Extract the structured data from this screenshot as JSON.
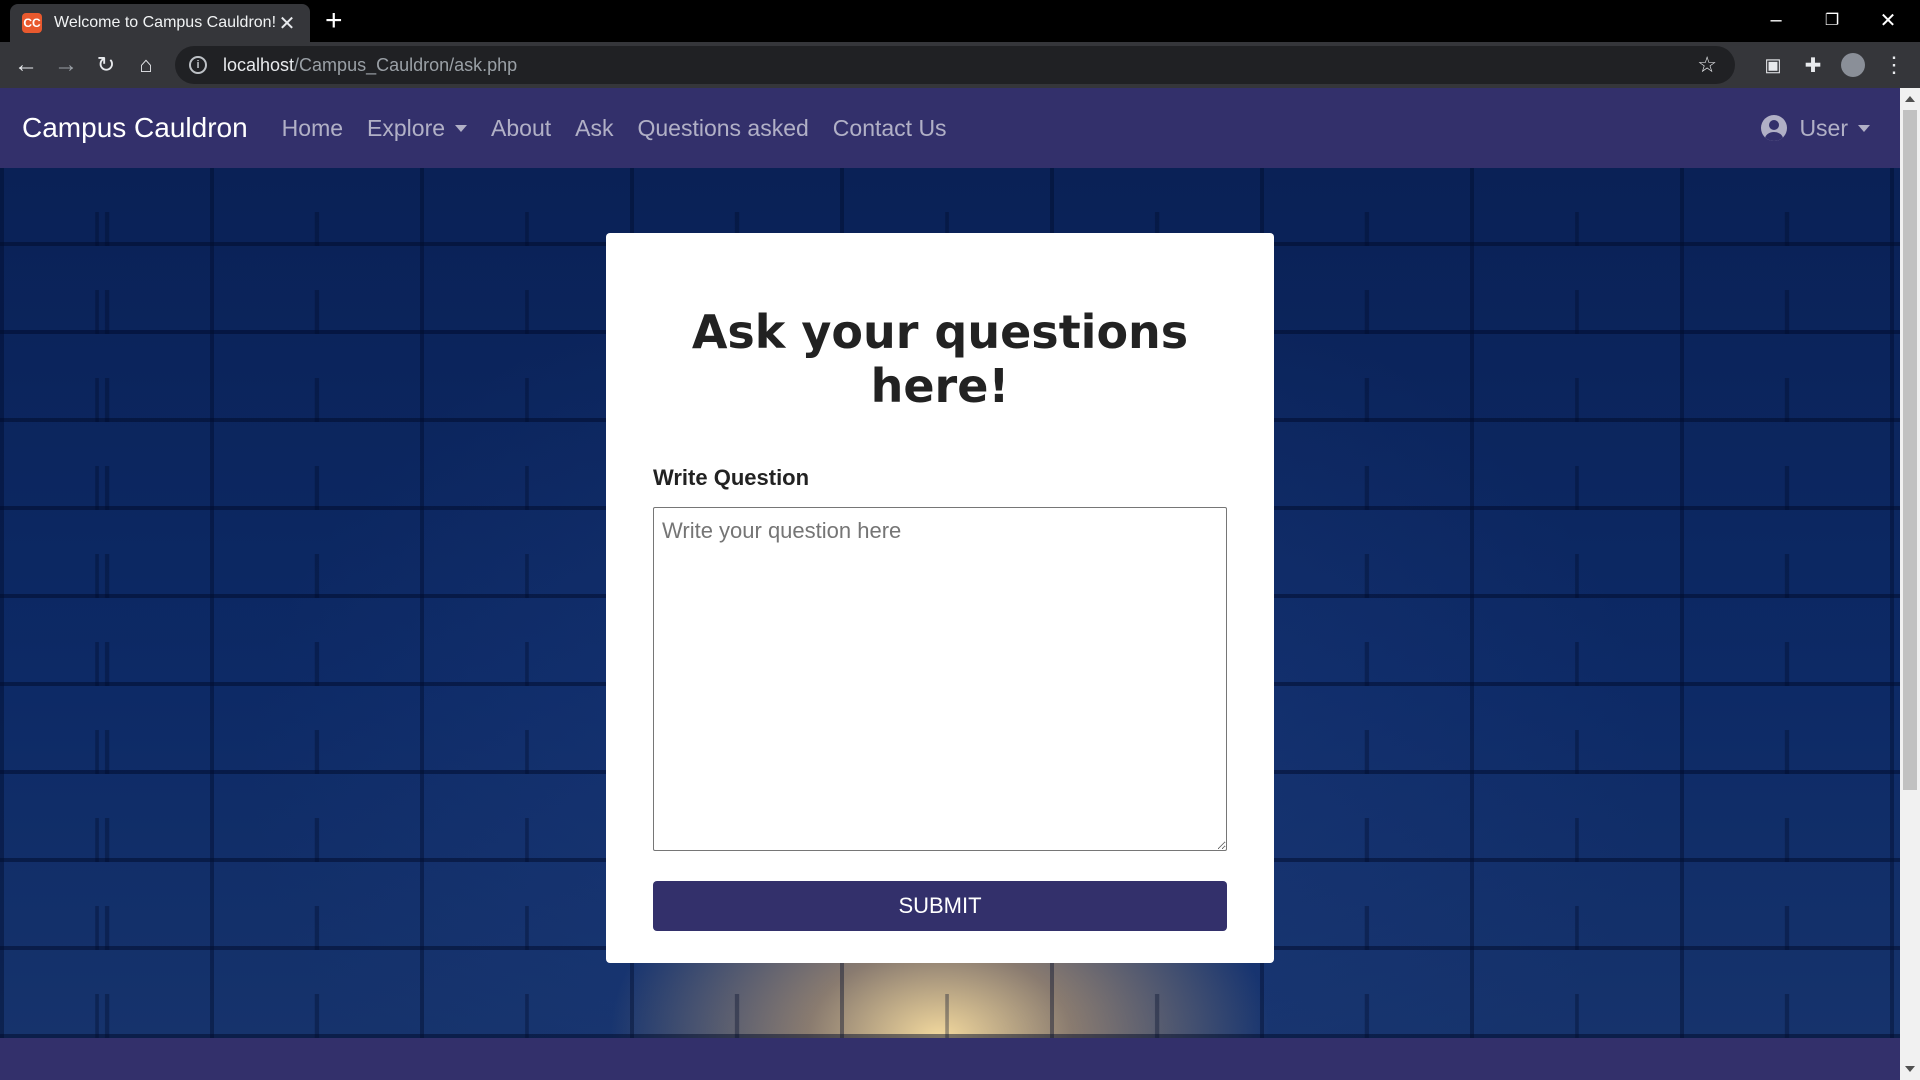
{
  "browser": {
    "tab_title": "Welcome to Campus Cauldron!",
    "favicon_text": "CC",
    "url_host": "localhost",
    "url_path": "/Campus_Cauldron/ask.php"
  },
  "navbar": {
    "brand": "Campus Cauldron",
    "links": [
      "Home",
      "Explore",
      "About",
      "Ask",
      "Questions asked",
      "Contact Us"
    ],
    "user_label": "User"
  },
  "form": {
    "title": "Ask your questions here!",
    "label": "Write Question",
    "placeholder": "Write your question here",
    "submit_label": "SUBMIT"
  },
  "colors": {
    "navbar_bg": "#33306b",
    "button_bg": "#33306b",
    "background": "#0b2456"
  }
}
